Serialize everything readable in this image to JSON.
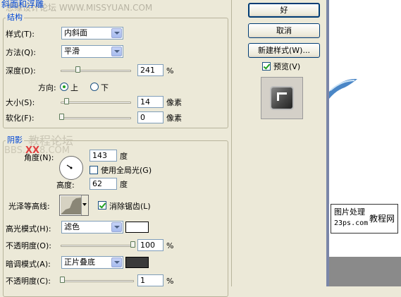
{
  "watermark_top": "思缘设计论坛 WWW.MISSYUAN.COM",
  "section_title": "斜面和浮雕",
  "structure": {
    "title": "结构",
    "style": {
      "label": "样式(T):",
      "value": "内斜面"
    },
    "technique": {
      "label": "方法(Q):",
      "value": "平滑"
    },
    "depth": {
      "label": "深度(D):",
      "value": "241",
      "unit": "%",
      "level": 0.24
    },
    "direction": {
      "label": "方向:",
      "up": "上",
      "down": "下",
      "selected": "上"
    },
    "size": {
      "label": "大小(S):",
      "value": "14",
      "unit": "像素",
      "level": 0.06
    },
    "soften": {
      "label": "软化(F):",
      "value": "0",
      "unit": "像素",
      "level": 0.0
    }
  },
  "shading": {
    "title": "阴影",
    "watermark_cn": "教程论坛",
    "watermark_bbs": "BBS.",
    "watermark_xx": "XX",
    "watermark_com": "8.COM",
    "angle": {
      "label": "角度(N):",
      "value": "143",
      "unit": "度"
    },
    "global_light": {
      "label": "使用全局光(G)",
      "checked": false
    },
    "altitude": {
      "label": "高度:",
      "value": "62",
      "unit": "度"
    },
    "gloss_contour": {
      "label": "光泽等高线:"
    },
    "anti_aliased": {
      "label": "消除锯齿(L)",
      "checked": true
    },
    "highlight_mode": {
      "label": "高光模式(H):",
      "value": "滤色",
      "color": "#ffffff"
    },
    "highlight_opacity": {
      "label": "不透明度(O):",
      "value": "100",
      "unit": "%",
      "level": 1.0
    },
    "shadow_mode": {
      "label": "暗调模式(A):",
      "value": "正片叠底",
      "color": "#3a3a3a"
    },
    "shadow_opacity": {
      "label": "不透明度(C):",
      "value": "1",
      "unit": "%",
      "level": 0.01
    }
  },
  "buttons": {
    "ok": "好",
    "cancel": "取消",
    "new_style": "新建样式(W)..."
  },
  "preview": {
    "label": "预览(V)",
    "checked": true
  },
  "badge": {
    "line1": "图片处理",
    "line2": "23ps.com",
    "line3": "教程网"
  },
  "colors": {
    "accent_title": "#0046d5",
    "canvas_bg": "#4466aa",
    "dialog_bg": "#ece9d8"
  }
}
